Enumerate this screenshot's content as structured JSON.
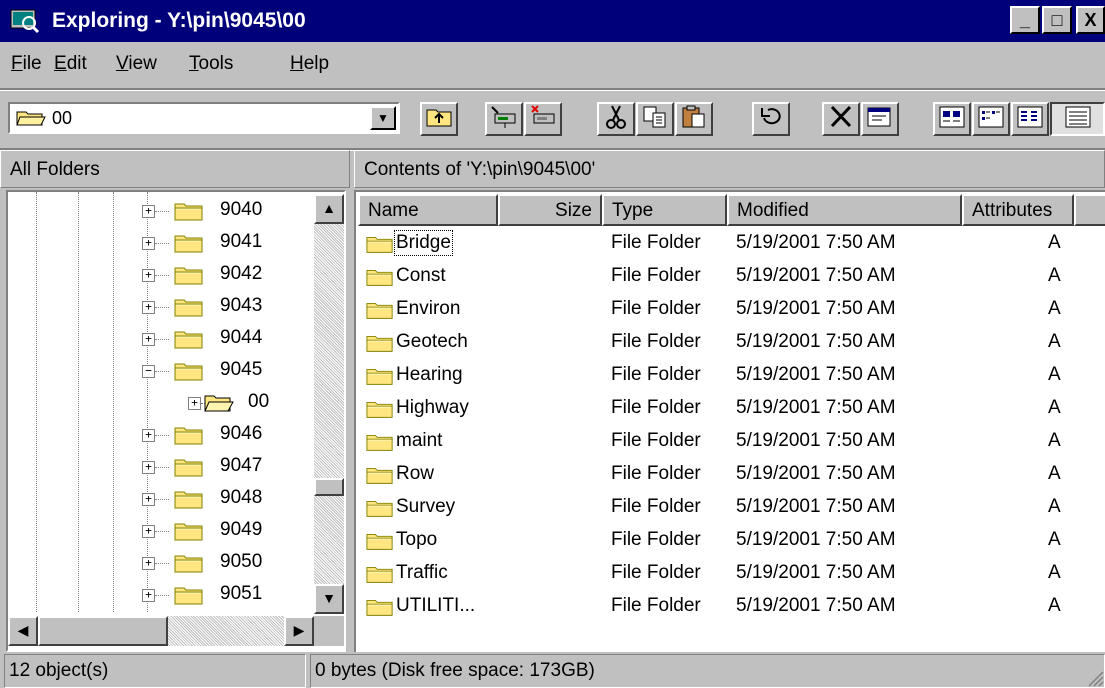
{
  "window": {
    "title": "Exploring - Y:\\pin\\9045\\00",
    "minimize_glyph": "_",
    "maximize_glyph": "□",
    "close_glyph": "X"
  },
  "menu": [
    {
      "label": "File",
      "accel": "F",
      "rest": "ile"
    },
    {
      "label": "Edit",
      "accel": "E",
      "rest": "dit"
    },
    {
      "label": "View",
      "accel": "V",
      "rest": "iew"
    },
    {
      "label": "Tools",
      "accel": "T",
      "rest": "ools"
    },
    {
      "label": "Help",
      "accel": "H",
      "rest": "elp"
    }
  ],
  "address": {
    "value": "00",
    "icon": "open-folder-icon"
  },
  "toolbar": [
    {
      "name": "up-one-level",
      "icon": "up-folder-icon"
    },
    {
      "name": "map-network-drive",
      "icon": "map-drive-icon"
    },
    {
      "name": "disconnect-network-drive",
      "icon": "disconnect-drive-icon"
    },
    {
      "name": "cut",
      "icon": "scissors-icon"
    },
    {
      "name": "copy",
      "icon": "copy-icon"
    },
    {
      "name": "paste",
      "icon": "paste-icon"
    },
    {
      "name": "undo",
      "icon": "undo-icon"
    },
    {
      "name": "delete",
      "icon": "delete-icon"
    },
    {
      "name": "properties",
      "icon": "properties-icon"
    },
    {
      "name": "large-icons",
      "icon": "large-icons-icon"
    },
    {
      "name": "small-icons",
      "icon": "small-icons-icon"
    },
    {
      "name": "list",
      "icon": "list-view-icon"
    },
    {
      "name": "details",
      "icon": "details-view-icon"
    }
  ],
  "tree": {
    "header": "All Folders",
    "items": [
      {
        "label": "9040",
        "expander": "+",
        "open": false
      },
      {
        "label": "9041",
        "expander": "+",
        "open": false
      },
      {
        "label": "9042",
        "expander": "+",
        "open": false
      },
      {
        "label": "9043",
        "expander": "+",
        "open": false
      },
      {
        "label": "9044",
        "expander": "+",
        "open": false
      },
      {
        "label": "9045",
        "expander": "−",
        "open": false
      },
      {
        "label": "00",
        "expander": "+",
        "open": true
      },
      {
        "label": "9046",
        "expander": "+",
        "open": false
      },
      {
        "label": "9047",
        "expander": "+",
        "open": false
      },
      {
        "label": "9048",
        "expander": "+",
        "open": false
      },
      {
        "label": "9049",
        "expander": "+",
        "open": false
      },
      {
        "label": "9050",
        "expander": "+",
        "open": false
      },
      {
        "label": "9051",
        "expander": "+",
        "open": false
      }
    ]
  },
  "list": {
    "header": "Contents of 'Y:\\pin\\9045\\00'",
    "columns": [
      "Name",
      "Size",
      "Type",
      "Modified",
      "Attributes"
    ],
    "rows": [
      {
        "name": "Bridge",
        "size": "",
        "type": "File Folder",
        "modified": "5/19/2001 7:50 AM",
        "attr": "A"
      },
      {
        "name": "Const",
        "size": "",
        "type": "File Folder",
        "modified": "5/19/2001 7:50 AM",
        "attr": "A"
      },
      {
        "name": "Environ",
        "size": "",
        "type": "File Folder",
        "modified": "5/19/2001 7:50 AM",
        "attr": "A"
      },
      {
        "name": "Geotech",
        "size": "",
        "type": "File Folder",
        "modified": "5/19/2001 7:50 AM",
        "attr": "A"
      },
      {
        "name": "Hearing",
        "size": "",
        "type": "File Folder",
        "modified": "5/19/2001 7:50 AM",
        "attr": "A"
      },
      {
        "name": "Highway",
        "size": "",
        "type": "File Folder",
        "modified": "5/19/2001 7:50 AM",
        "attr": "A"
      },
      {
        "name": "maint",
        "size": "",
        "type": "File Folder",
        "modified": "5/19/2001 7:50 AM",
        "attr": "A"
      },
      {
        "name": "Row",
        "size": "",
        "type": "File Folder",
        "modified": "5/19/2001 7:50 AM",
        "attr": "A"
      },
      {
        "name": "Survey",
        "size": "",
        "type": "File Folder",
        "modified": "5/19/2001 7:50 AM",
        "attr": "A"
      },
      {
        "name": "Topo",
        "size": "",
        "type": "File Folder",
        "modified": "5/19/2001 7:50 AM",
        "attr": "A"
      },
      {
        "name": "Traffic",
        "size": "",
        "type": "File Folder",
        "modified": "5/19/2001 7:50 AM",
        "attr": "A"
      },
      {
        "name": "UTILITI...",
        "size": "",
        "type": "File Folder",
        "modified": "5/19/2001 7:50 AM",
        "attr": "A"
      }
    ]
  },
  "status": {
    "objects": "12 object(s)",
    "space": "0 bytes (Disk free space: 173GB)"
  },
  "colors": {
    "titlebar": "#00007b",
    "face": "#c0c0c0",
    "folder": "#ffe680",
    "folder_edge": "#808000"
  }
}
